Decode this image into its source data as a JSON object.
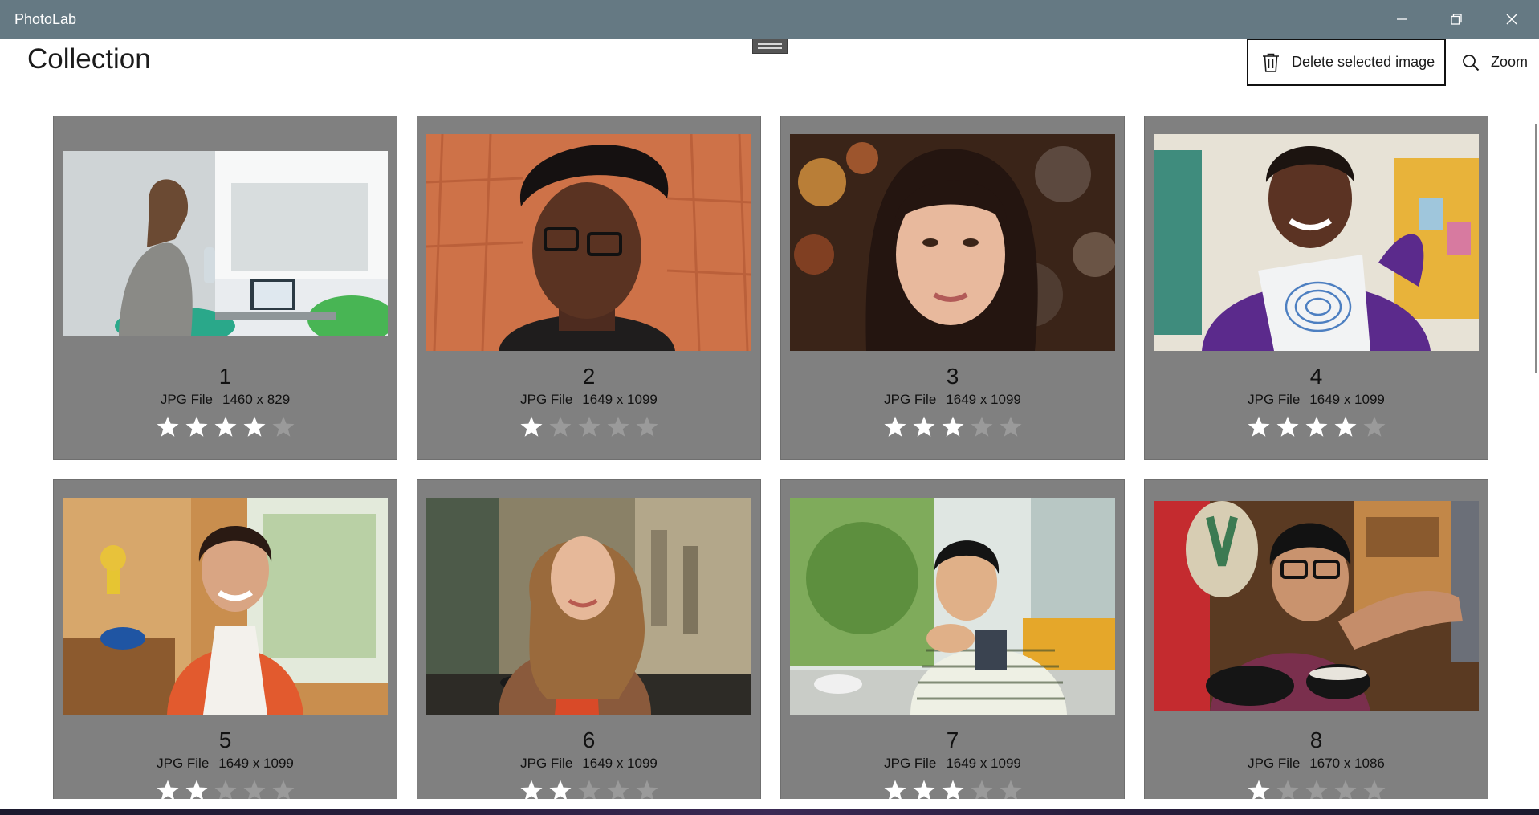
{
  "window": {
    "title": "PhotoLab",
    "controls": [
      "minimize-icon",
      "restore-icon",
      "close-icon"
    ]
  },
  "header": {
    "title": "Collection"
  },
  "commands": {
    "delete_label": "Delete selected image",
    "delete_icon": "trash-icon",
    "zoom_label": "Zoom",
    "zoom_icon": "search-icon"
  },
  "colors": {
    "titlebar": "#657983",
    "card_background": "#808080",
    "star_filled": "#ffffff",
    "star_empty": "#9a9a9a"
  },
  "photos": [
    {
      "number": "1",
      "type": "JPG File",
      "dimensions": "1460 x 829",
      "rating": 4,
      "max_rating": 5
    },
    {
      "number": "2",
      "type": "JPG File",
      "dimensions": "1649 x 1099",
      "rating": 1,
      "max_rating": 5
    },
    {
      "number": "3",
      "type": "JPG File",
      "dimensions": "1649 x 1099",
      "rating": 3,
      "max_rating": 5
    },
    {
      "number": "4",
      "type": "JPG File",
      "dimensions": "1649 x 1099",
      "rating": 4,
      "max_rating": 5
    },
    {
      "number": "5",
      "type": "JPG File",
      "dimensions": "1649 x 1099",
      "rating": 2,
      "max_rating": 5
    },
    {
      "number": "6",
      "type": "JPG File",
      "dimensions": "1649 x 1099",
      "rating": 2,
      "max_rating": 5
    },
    {
      "number": "7",
      "type": "JPG File",
      "dimensions": "1649 x 1099",
      "rating": 3,
      "max_rating": 5
    },
    {
      "number": "8",
      "type": "JPG File",
      "dimensions": "1670 x 1086",
      "rating": 1,
      "max_rating": 5
    }
  ]
}
